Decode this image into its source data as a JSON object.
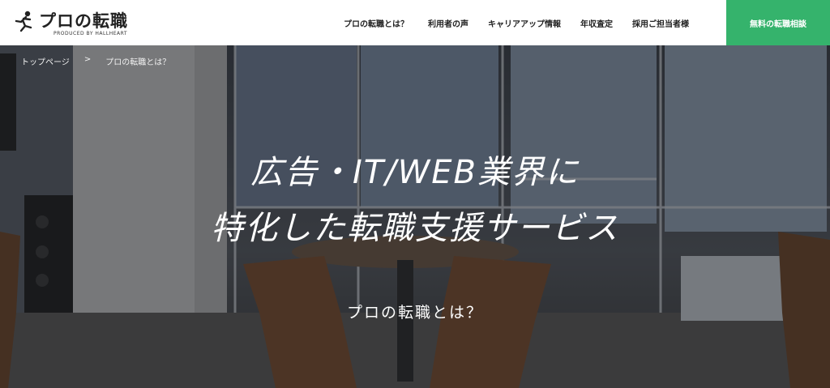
{
  "header": {
    "logo": {
      "name": "プロの転職",
      "sub": "PRODUCED BY HALLHEART"
    },
    "nav": [
      {
        "label": "プロの転職とは？"
      },
      {
        "label": "利用者の声"
      },
      {
        "label": "キャリアアップ情報"
      },
      {
        "label": "年収査定"
      },
      {
        "label": "採用ご担当者様"
      }
    ],
    "cta": "無料の転職相談"
  },
  "breadcrumb": {
    "home": "トップページ",
    "separator": ">",
    "current": "プロの転職とは？"
  },
  "hero": {
    "title_line1": "広告・IT/WEB業界に",
    "title_line2": "特化した転職支援サービス",
    "subtitle": "プロの転職とは？"
  },
  "colors": {
    "cta": "#35b36c"
  }
}
